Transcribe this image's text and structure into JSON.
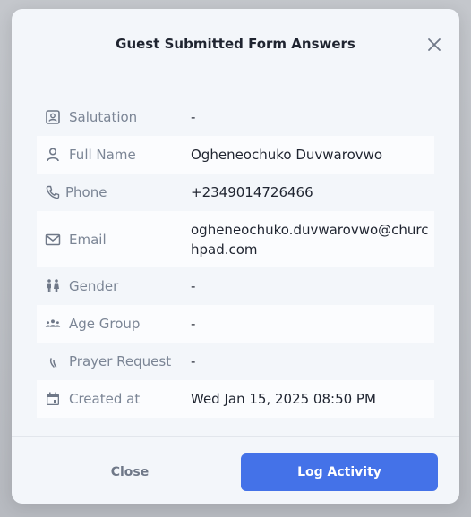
{
  "modal": {
    "title": "Guest Submitted Form Answers",
    "close_icon": "close-icon"
  },
  "fields": [
    {
      "label": "Salutation",
      "value": "-",
      "icon": "id-badge-icon"
    },
    {
      "label": "Full Name",
      "value": "Ogheneochuko Duvwarovwo",
      "icon": "person-icon"
    },
    {
      "label": "Phone",
      "value": "+2349014726466",
      "icon": "phone-icon"
    },
    {
      "label": "Email",
      "value": "ogheneochuko.duvwarovwo@churchpad.com",
      "icon": "mail-icon"
    },
    {
      "label": "Gender",
      "value": "-",
      "icon": "gender-icon"
    },
    {
      "label": "Age Group",
      "value": "-",
      "icon": "group-icon"
    },
    {
      "label": "Prayer Request",
      "value": "-",
      "icon": "prayer-icon"
    },
    {
      "label": "Created at",
      "value": "Wed Jan 15, 2025 08:50 PM",
      "icon": "calendar-icon"
    }
  ],
  "footer": {
    "close_label": "Close",
    "log_label": "Log Activity"
  },
  "colors": {
    "primary": "#4472e8",
    "label": "#7b8595",
    "value": "#1f2430"
  }
}
